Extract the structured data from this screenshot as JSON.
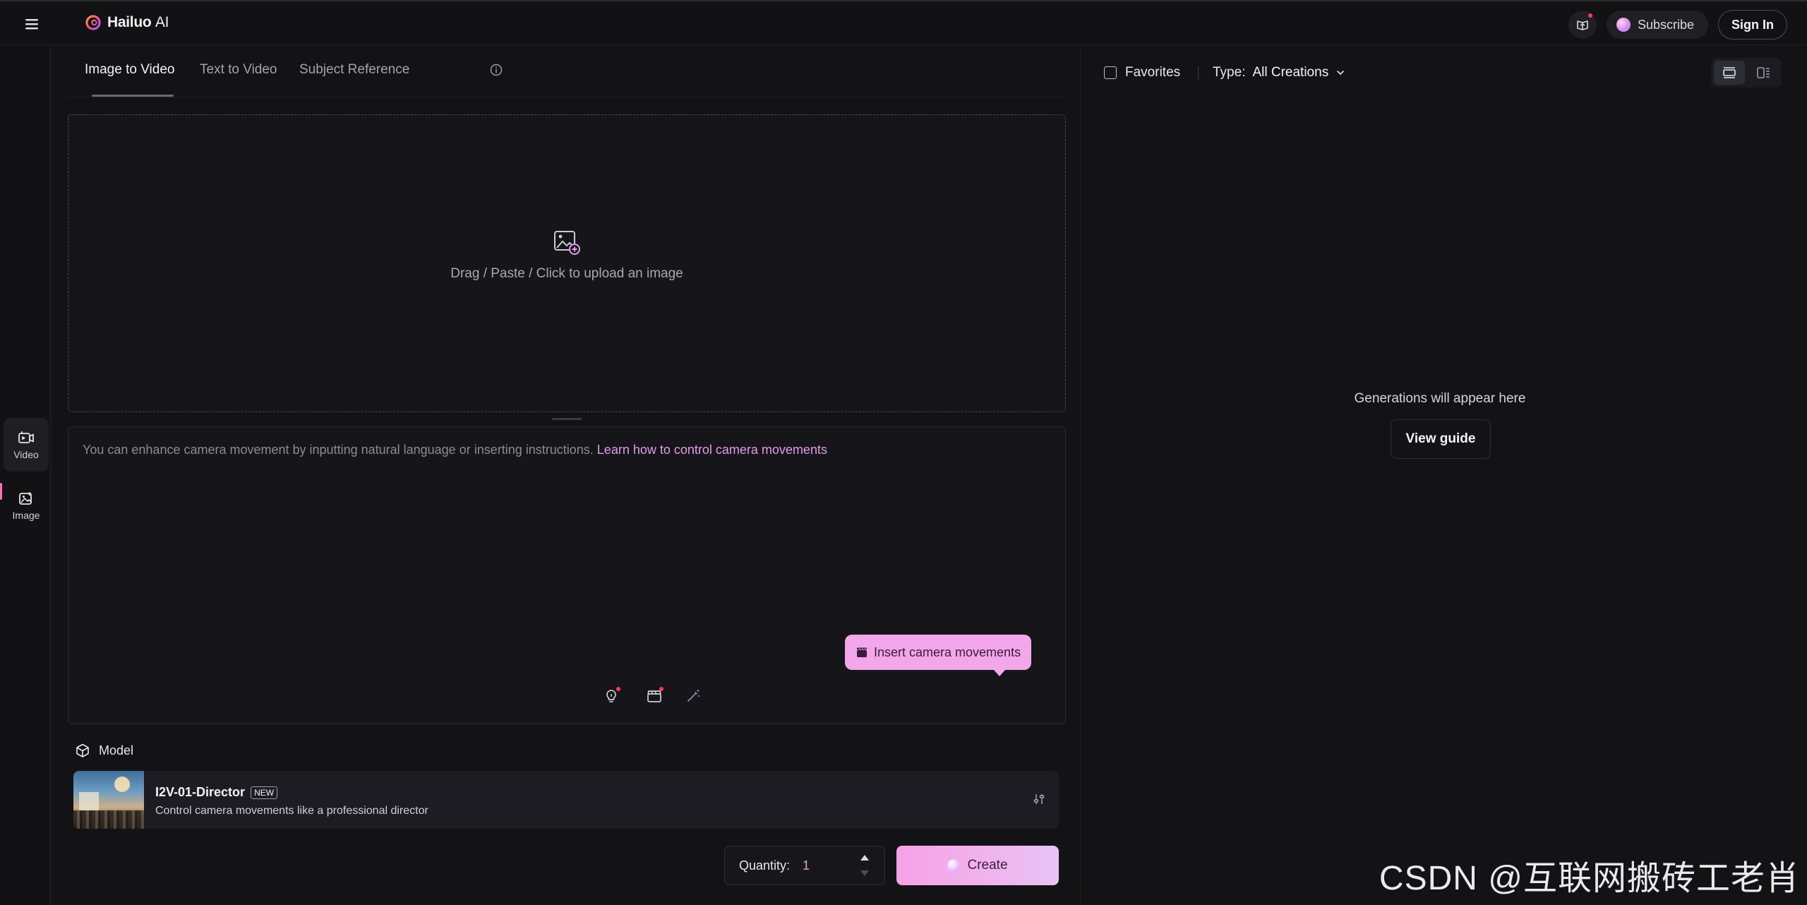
{
  "header": {
    "brand_name": "Hailuo",
    "brand_suffix": "AI",
    "subscribe_label": "Subscribe",
    "signin_label": "Sign In"
  },
  "sidebar": {
    "items": [
      {
        "label": "Video",
        "icon": "video-icon",
        "active": true
      },
      {
        "label": "Image",
        "icon": "image-icon",
        "active": false
      }
    ]
  },
  "tabs": [
    {
      "label": "Image to Video",
      "active": true
    },
    {
      "label": "Text to Video",
      "active": false
    },
    {
      "label": "Subject Reference",
      "active": false
    }
  ],
  "upload": {
    "text": "Drag / Paste / Click to upload an image"
  },
  "prompt": {
    "placeholder": "You can enhance camera movement by inputting natural language or inserting instructions.",
    "link": "Learn how to control camera movements",
    "tooltip": "Insert camera movements"
  },
  "model": {
    "section_label": "Model",
    "name": "I2V-01-Director",
    "badge": "NEW",
    "description": "Control camera movements like a professional director"
  },
  "quantity": {
    "label": "Quantity:",
    "value": "1"
  },
  "create_label": "Create",
  "gallery": {
    "favorites_label": "Favorites",
    "type_label": "Type:",
    "type_value": "All Creations",
    "empty_text": "Generations will appear here",
    "view_guide_label": "View guide"
  },
  "watermark": "CSDN @互联网搬砖工老肖",
  "colors": {
    "accent_pink": "#f7a2e6",
    "link_pink": "#e49be8",
    "background": "#131316",
    "notification": "#ff3b4e"
  }
}
